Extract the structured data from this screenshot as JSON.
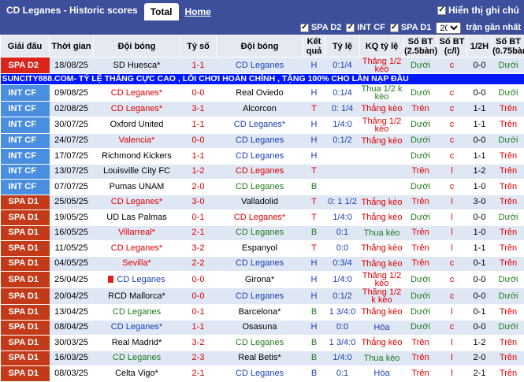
{
  "header": {
    "title": "CD Leganes - Historic scores",
    "tab_total": "Total",
    "tab_home": "Home",
    "note_label": "Hiển thị ghi chú",
    "check_mark": "✓"
  },
  "filters": {
    "items": [
      "SPA D2",
      "INT CF",
      "SPA D1"
    ],
    "count": "20",
    "suffix": "trận gần nhất"
  },
  "columns": [
    "Giải đấu",
    "Thời gian",
    "Đội bóng",
    "Tỷ số",
    "Đội bóng",
    "Kết quả",
    "Tỷ lệ",
    "KQ tỷ lệ",
    "Số BT (2.5bàn)",
    "Số BT (c/l)",
    "1/2H",
    "Số BT (0.75bàn)"
  ],
  "colors": {
    "SPA D2": "#d9261c",
    "INT CF": "#4a8ee0",
    "SPA D1": "#c23a18"
  },
  "ad": "SUNCITY888.COM- TỶ LỆ THẮNG CỰC CAO , LỐI CHƠI HOÀN CHỈNH , TẶNG 100% CHO LẦN NẠP ĐẦU",
  "rows": [
    {
      "league": "SPA D2",
      "date": "18/08/25",
      "home": "SD Huesca*",
      "hc": "black",
      "score": "1-1",
      "away": "CD Leganes",
      "ac": "blue",
      "res": "H",
      "rc": "blue",
      "odds": "0:1/4",
      "kq": "Thắng 1/2 kèo",
      "kc": "red",
      "ou": "Dưới",
      "oc": "green",
      "cl": "c",
      "cc": "red",
      "ht": "0-0",
      "htc": "black",
      "ou2": "Dưới",
      "o2c": "green"
    },
    {
      "ad": true
    },
    {
      "league": "INT CF",
      "date": "09/08/25",
      "home": "CD Leganes*",
      "hc": "red",
      "score": "0-0",
      "away": "Real Oviedo",
      "ac": "black",
      "res": "H",
      "rc": "blue",
      "odds": "0:1/4",
      "kq": "Thua 1/2 k kèo",
      "kc": "green",
      "ou": "Dưới",
      "oc": "green",
      "cl": "c",
      "cc": "red",
      "ht": "0-0",
      "htc": "black",
      "ou2": "Dưới",
      "o2c": "green"
    },
    {
      "league": "INT CF",
      "date": "02/08/25",
      "home": "CD Leganes*",
      "hc": "red",
      "score": "3-1",
      "away": "Alcorcon",
      "ac": "black",
      "res": "T",
      "rc": "red",
      "odds": "0: 1/4",
      "kq": "Thắng kèo",
      "kc": "red",
      "ou": "Trên",
      "oc": "red",
      "cl": "c",
      "cc": "red",
      "ht": "1-1",
      "htc": "black",
      "ou2": "Trên",
      "o2c": "red"
    },
    {
      "league": "INT CF",
      "date": "30/07/25",
      "home": "Oxford United",
      "hc": "black",
      "score": "1-1",
      "away": "CD Leganes*",
      "ac": "blue",
      "res": "H",
      "rc": "blue",
      "odds": "1/4:0",
      "kq": "Thắng 1/2 kèo",
      "kc": "red",
      "ou": "Dưới",
      "oc": "green",
      "cl": "c",
      "cc": "red",
      "ht": "1-1",
      "htc": "black",
      "ou2": "Trên",
      "o2c": "red"
    },
    {
      "league": "INT CF",
      "date": "24/07/25",
      "home": "Valencia*",
      "hc": "red",
      "score": "0-0",
      "away": "CD Leganes",
      "ac": "blue",
      "res": "H",
      "rc": "blue",
      "odds": "0:1/2",
      "kq": "Thắng kèo",
      "kc": "red",
      "ou": "Dưới",
      "oc": "green",
      "cl": "c",
      "cc": "red",
      "ht": "0-0",
      "htc": "black",
      "ou2": "Dưới",
      "o2c": "green"
    },
    {
      "league": "INT CF",
      "date": "17/07/25",
      "home": "Richmond Kickers",
      "hc": "black",
      "score": "1-1",
      "away": "CD Leganes",
      "ac": "blue",
      "res": "H",
      "rc": "blue",
      "odds": "",
      "kq": "",
      "kc": "red",
      "ou": "Dưới",
      "oc": "green",
      "cl": "c",
      "cc": "red",
      "ht": "1-1",
      "htc": "black",
      "ou2": "Trên",
      "o2c": "red"
    },
    {
      "league": "INT CF",
      "date": "13/07/25",
      "home": "Louisville City FC",
      "hc": "black",
      "score": "1-2",
      "away": "CD Leganes",
      "ac": "red",
      "res": "T",
      "rc": "red",
      "odds": "",
      "kq": "",
      "kc": "red",
      "ou": "Trên",
      "oc": "red",
      "cl": "l",
      "cc": "red",
      "ht": "1-2",
      "htc": "black",
      "ou2": "Trên",
      "o2c": "red"
    },
    {
      "league": "INT CF",
      "date": "07/07/25",
      "home": "Pumas UNAM",
      "hc": "black",
      "score": "2-0",
      "away": "CD Leganes",
      "ac": "green",
      "res": "B",
      "rc": "green",
      "odds": "",
      "kq": "",
      "kc": "red",
      "ou": "Dưới",
      "oc": "green",
      "cl": "c",
      "cc": "red",
      "ht": "1-0",
      "htc": "black",
      "ou2": "Trên",
      "o2c": "red"
    },
    {
      "league": "SPA D1",
      "date": "25/05/25",
      "home": "CD Leganes*",
      "hc": "red",
      "score": "3-0",
      "away": "Valladolid",
      "ac": "black",
      "res": "T",
      "rc": "red",
      "odds": "0: 1 1/2",
      "kq": "Thắng kèo",
      "kc": "red",
      "ou": "Trên",
      "oc": "red",
      "cl": "l",
      "cc": "red",
      "ht": "3-0",
      "htc": "black",
      "ou2": "Trên",
      "o2c": "red"
    },
    {
      "league": "SPA D1",
      "date": "19/05/25",
      "home": "UD Las Palmas",
      "hc": "black",
      "score": "0-1",
      "away": "CD Leganes*",
      "ac": "red",
      "res": "T",
      "rc": "red",
      "odds": "1/4:0",
      "kq": "Thắng kèo",
      "kc": "red",
      "ou": "Dưới",
      "oc": "green",
      "cl": "l",
      "cc": "red",
      "ht": "0-0",
      "htc": "black",
      "ou2": "Dưới",
      "o2c": "green"
    },
    {
      "league": "SPA D1",
      "date": "16/05/25",
      "home": "Villarreal*",
      "hc": "red",
      "score": "2-1",
      "away": "CD Leganes",
      "ac": "green",
      "res": "B",
      "rc": "green",
      "odds": "0:1",
      "kq": "Thua kèo",
      "kc": "green",
      "ou": "Trên",
      "oc": "red",
      "cl": "l",
      "cc": "red",
      "ht": "1-0",
      "htc": "black",
      "ou2": "Trên",
      "o2c": "red"
    },
    {
      "league": "SPA D1",
      "date": "11/05/25",
      "home": "CD Leganes*",
      "hc": "red",
      "score": "3-2",
      "away": "Espanyol",
      "ac": "black",
      "res": "T",
      "rc": "red",
      "odds": "0:0",
      "kq": "Thắng kèo",
      "kc": "red",
      "ou": "Trên",
      "oc": "red",
      "cl": "l",
      "cc": "red",
      "ht": "1-1",
      "htc": "black",
      "ou2": "Trên",
      "o2c": "red"
    },
    {
      "league": "SPA D1",
      "date": "04/05/25",
      "home": "Sevilla*",
      "hc": "red",
      "score": "2-2",
      "away": "CD Leganes",
      "ac": "blue",
      "res": "H",
      "rc": "blue",
      "odds": "0:3/4",
      "kq": "Thắng kèo",
      "kc": "red",
      "ou": "Trên",
      "oc": "red",
      "cl": "c",
      "cc": "red",
      "ht": "0-1",
      "htc": "black",
      "ou2": "Trên",
      "o2c": "red"
    },
    {
      "league": "SPA D1",
      "date": "25/04/25",
      "home": "CD Leganes",
      "hc": "blue",
      "flag": true,
      "score": "0-0",
      "away": "Girona*",
      "ac": "black",
      "res": "H",
      "rc": "blue",
      "odds": "1/4:0",
      "kq": "Thắng 1/2 kèo",
      "kc": "red",
      "ou": "Dưới",
      "oc": "green",
      "cl": "c",
      "cc": "red",
      "ht": "0-0",
      "htc": "black",
      "ou2": "Dưới",
      "o2c": "green"
    },
    {
      "league": "SPA D1",
      "date": "20/04/25",
      "home": "RCD Mallorca*",
      "hc": "black",
      "score": "0-0",
      "away": "CD Leganes",
      "ac": "blue",
      "res": "H",
      "rc": "blue",
      "odds": "0:1/2",
      "kq": "Thắng 1/2 k kèo",
      "kc": "red",
      "ou": "Dưới",
      "oc": "green",
      "cl": "c",
      "cc": "red",
      "ht": "0-0",
      "htc": "black",
      "ou2": "Dưới",
      "o2c": "green"
    },
    {
      "league": "SPA D1",
      "date": "13/04/25",
      "home": "CD Leganes",
      "hc": "green",
      "score": "0-1",
      "away": "Barcelona*",
      "ac": "black",
      "res": "B",
      "rc": "green",
      "odds": "1 3/4:0",
      "kq": "Thắng kèo",
      "kc": "red",
      "ou": "Dưới",
      "oc": "green",
      "cl": "l",
      "cc": "red",
      "ht": "0-1",
      "htc": "black",
      "ou2": "Trên",
      "o2c": "red"
    },
    {
      "league": "SPA D1",
      "date": "08/04/25",
      "home": "CD Leganes*",
      "hc": "blue",
      "score": "1-1",
      "away": "Osasuna",
      "ac": "black",
      "res": "H",
      "rc": "blue",
      "odds": "0:0",
      "kq": "Hòa",
      "kc": "blue",
      "ou": "Dưới",
      "oc": "green",
      "cl": "c",
      "cc": "red",
      "ht": "0-0",
      "htc": "black",
      "ou2": "Dưới",
      "o2c": "green"
    },
    {
      "league": "SPA D1",
      "date": "30/03/25",
      "home": "Real Madrid*",
      "hc": "black",
      "score": "3-2",
      "away": "CD Leganes",
      "ac": "green",
      "res": "B",
      "rc": "green",
      "odds": "1 3/4:0",
      "kq": "Thắng kèo",
      "kc": "red",
      "ou": "Trên",
      "oc": "red",
      "cl": "l",
      "cc": "red",
      "ht": "1-2",
      "htc": "black",
      "ou2": "Trên",
      "o2c": "red"
    },
    {
      "league": "SPA D1",
      "date": "16/03/25",
      "home": "CD Leganes",
      "hc": "green",
      "score": "2-3",
      "away": "Real Betis*",
      "ac": "black",
      "res": "B",
      "rc": "green",
      "odds": "1/4:0",
      "kq": "Thua kèo",
      "kc": "green",
      "ou": "Trên",
      "oc": "red",
      "cl": "l",
      "cc": "red",
      "ht": "2-0",
      "htc": "black",
      "ou2": "Trên",
      "o2c": "red"
    },
    {
      "league": "SPA D1",
      "date": "08/03/25",
      "home": "Celta Vigo*",
      "hc": "black",
      "score": "2-1",
      "away": "CD Leganes",
      "ac": "blue",
      "res": "B",
      "rc": "blue",
      "odds": "0:1",
      "kq": "Hòa",
      "kc": "blue",
      "ou": "Trên",
      "oc": "red",
      "cl": "l",
      "cc": "red",
      "ht": "2-1",
      "htc": "black",
      "ou2": "Trên",
      "o2c": "red"
    }
  ]
}
